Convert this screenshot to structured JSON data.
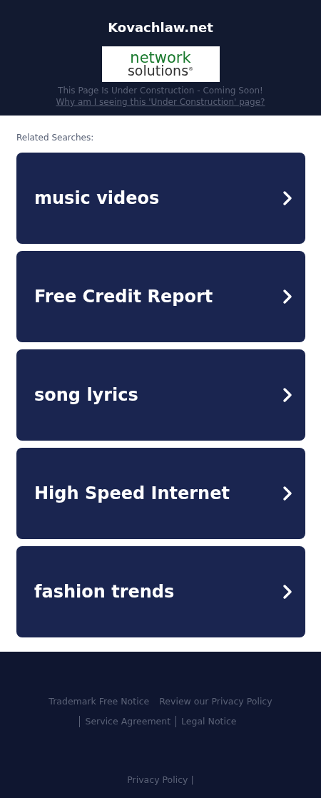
{
  "header": {
    "title": "Kovachlaw.net",
    "logo": {
      "line_1": "network",
      "line_2": "solutions",
      "mark": "®"
    },
    "notice": "This Page Is Under Construction - Coming Soon!",
    "notice_link": "Why am I seeing this 'Under Construction' page?"
  },
  "related": {
    "heading": "Related Searches:",
    "items": [
      {
        "label": "music videos"
      },
      {
        "label": "Free Credit Report"
      },
      {
        "label": "song lyrics"
      },
      {
        "label": "High Speed Internet"
      },
      {
        "label": "fashion trends"
      }
    ]
  },
  "footer": {
    "links": [
      {
        "label": "Trademark Free Notice",
        "separator": false
      },
      {
        "label": "Review our Privacy Policy",
        "separator": false
      },
      {
        "label": "Service Agreement",
        "separator": true
      },
      {
        "label": "Legal Notice",
        "separator": true
      }
    ],
    "bottom_link": "Privacy Policy",
    "bottom_separator": "|"
  }
}
